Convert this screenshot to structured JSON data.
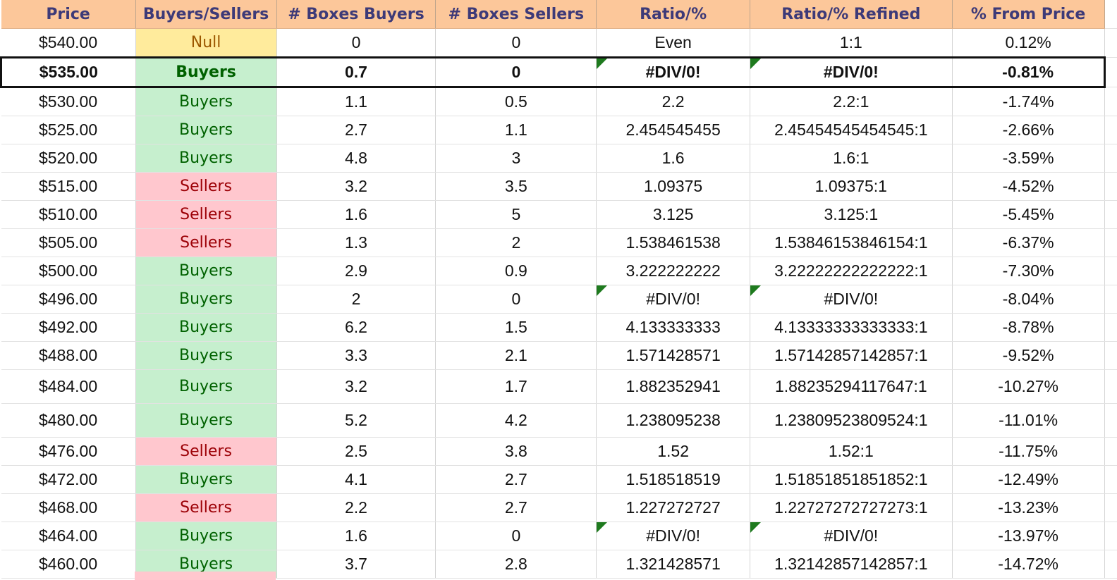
{
  "headers": [
    "Price",
    "Buyers/Sellers",
    "# Boxes Buyers",
    "# Boxes Sellers",
    "Ratio/%",
    "Ratio/% Refined",
    "% From Price"
  ],
  "colors": {
    "header_bg": "#fcc79a",
    "header_text": "#3d3a78",
    "buyers_bg": "#c6efce",
    "buyers_text": "#006100",
    "sellers_bg": "#ffc7ce",
    "sellers_text": "#9c0006",
    "null_bg": "#ffeb9c",
    "null_text": "#9c5700",
    "error_flag": "#1e7a1e"
  },
  "current_row_index": 1,
  "rows": [
    {
      "price": "$540.00",
      "side": "Null",
      "buyers": "0",
      "sellers": "0",
      "ratio": "Even",
      "refined": "1:1",
      "pct": "0.12%"
    },
    {
      "price": "$535.00",
      "side": "Buyers",
      "buyers": "0.7",
      "sellers": "0",
      "ratio": "#DIV/0!",
      "refined": "#DIV/0!",
      "pct": "-0.81%"
    },
    {
      "price": "$530.00",
      "side": "Buyers",
      "buyers": "1.1",
      "sellers": "0.5",
      "ratio": "2.2",
      "refined": "2.2:1",
      "pct": "-1.74%"
    },
    {
      "price": "$525.00",
      "side": "Buyers",
      "buyers": "2.7",
      "sellers": "1.1",
      "ratio": "2.454545455",
      "refined": "2.45454545454545:1",
      "pct": "-2.66%"
    },
    {
      "price": "$520.00",
      "side": "Buyers",
      "buyers": "4.8",
      "sellers": "3",
      "ratio": "1.6",
      "refined": "1.6:1",
      "pct": "-3.59%"
    },
    {
      "price": "$515.00",
      "side": "Sellers",
      "buyers": "3.2",
      "sellers": "3.5",
      "ratio": "1.09375",
      "refined": "1.09375:1",
      "pct": "-4.52%"
    },
    {
      "price": "$510.00",
      "side": "Sellers",
      "buyers": "1.6",
      "sellers": "5",
      "ratio": "3.125",
      "refined": "3.125:1",
      "pct": "-5.45%"
    },
    {
      "price": "$505.00",
      "side": "Sellers",
      "buyers": "1.3",
      "sellers": "2",
      "ratio": "1.538461538",
      "refined": "1.53846153846154:1",
      "pct": "-6.37%"
    },
    {
      "price": "$500.00",
      "side": "Buyers",
      "buyers": "2.9",
      "sellers": "0.9",
      "ratio": "3.222222222",
      "refined": "3.22222222222222:1",
      "pct": "-7.30%"
    },
    {
      "price": "$496.00",
      "side": "Buyers",
      "buyers": "2",
      "sellers": "0",
      "ratio": "#DIV/0!",
      "refined": "#DIV/0!",
      "pct": "-8.04%"
    },
    {
      "price": "$492.00",
      "side": "Buyers",
      "buyers": "6.2",
      "sellers": "1.5",
      "ratio": "4.133333333",
      "refined": "4.13333333333333:1",
      "pct": "-8.78%"
    },
    {
      "price": "$488.00",
      "side": "Buyers",
      "buyers": "3.3",
      "sellers": "2.1",
      "ratio": "1.571428571",
      "refined": "1.57142857142857:1",
      "pct": "-9.52%"
    },
    {
      "price": "$484.00",
      "side": "Buyers",
      "buyers": "3.2",
      "sellers": "1.7",
      "ratio": "1.882352941",
      "refined": "1.88235294117647:1",
      "pct": "-10.27%"
    },
    {
      "price": "$480.00",
      "side": "Buyers",
      "buyers": "5.2",
      "sellers": "4.2",
      "ratio": "1.238095238",
      "refined": "1.23809523809524:1",
      "pct": "-11.01%"
    },
    {
      "price": "$476.00",
      "side": "Sellers",
      "buyers": "2.5",
      "sellers": "3.8",
      "ratio": "1.52",
      "refined": "1.52:1",
      "pct": "-11.75%"
    },
    {
      "price": "$472.00",
      "side": "Buyers",
      "buyers": "4.1",
      "sellers": "2.7",
      "ratio": "1.518518519",
      "refined": "1.51851851851852:1",
      "pct": "-12.49%"
    },
    {
      "price": "$468.00",
      "side": "Sellers",
      "buyers": "2.2",
      "sellers": "2.7",
      "ratio": "1.227272727",
      "refined": "1.22727272727273:1",
      "pct": "-13.23%"
    },
    {
      "price": "$464.00",
      "side": "Buyers",
      "buyers": "1.6",
      "sellers": "0",
      "ratio": "#DIV/0!",
      "refined": "#DIV/0!",
      "pct": "-13.97%"
    },
    {
      "price": "$460.00",
      "side": "Buyers",
      "buyers": "3.7",
      "sellers": "2.8",
      "ratio": "1.321428571",
      "refined": "1.32142857142857:1",
      "pct": "-14.72%"
    }
  ]
}
